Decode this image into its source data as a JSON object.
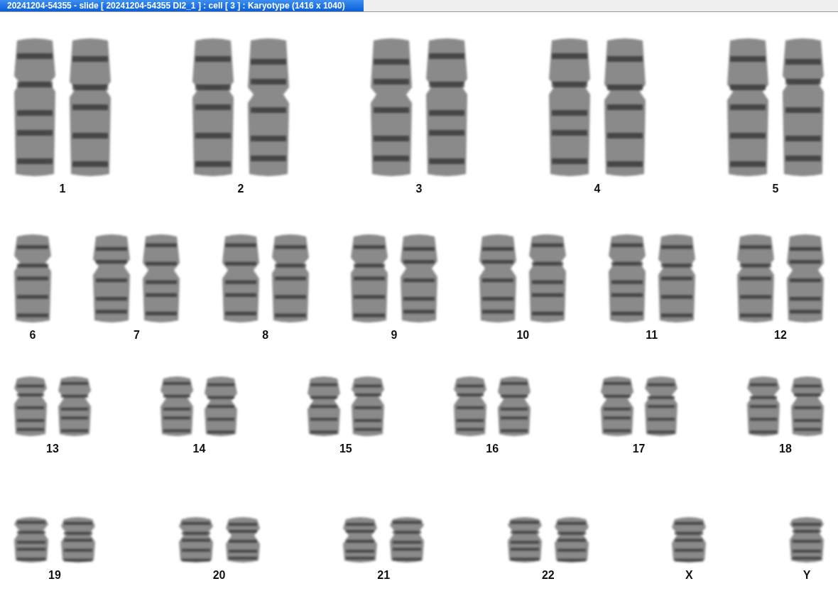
{
  "window": {
    "title": "20241204-54355 - slide [ 20241204-54355 DI2_1 ] : cell [ 3 ] : Karyotype  (1416 x 1040)"
  },
  "rows": [
    {
      "groups": [
        {
          "label": "1",
          "kind": "pair"
        },
        {
          "label": "2",
          "kind": "pair"
        },
        {
          "label": "3",
          "kind": "pair"
        },
        {
          "label": "4",
          "kind": "pair"
        },
        {
          "label": "5",
          "kind": "pair"
        }
      ]
    },
    {
      "groups": [
        {
          "label": "6",
          "kind": "single"
        },
        {
          "label": "7",
          "kind": "pair"
        },
        {
          "label": "8",
          "kind": "pair"
        },
        {
          "label": "9",
          "kind": "pair"
        },
        {
          "label": "10",
          "kind": "pair"
        },
        {
          "label": "11",
          "kind": "pair"
        },
        {
          "label": "12",
          "kind": "pair"
        }
      ]
    },
    {
      "groups": [
        {
          "label": "13",
          "kind": "pair"
        },
        {
          "label": "14",
          "kind": "pair"
        },
        {
          "label": "15",
          "kind": "pair"
        },
        {
          "label": "16",
          "kind": "pair"
        },
        {
          "label": "17",
          "kind": "pair"
        },
        {
          "label": "18",
          "kind": "pair"
        }
      ]
    },
    {
      "groups": [
        {
          "label": "19",
          "kind": "pair"
        },
        {
          "label": "20",
          "kind": "pair"
        },
        {
          "label": "21",
          "kind": "pair"
        },
        {
          "label": "22",
          "kind": "pair"
        },
        {
          "label": "X",
          "kind": "single"
        },
        {
          "label": "Y",
          "kind": "single"
        }
      ]
    }
  ]
}
